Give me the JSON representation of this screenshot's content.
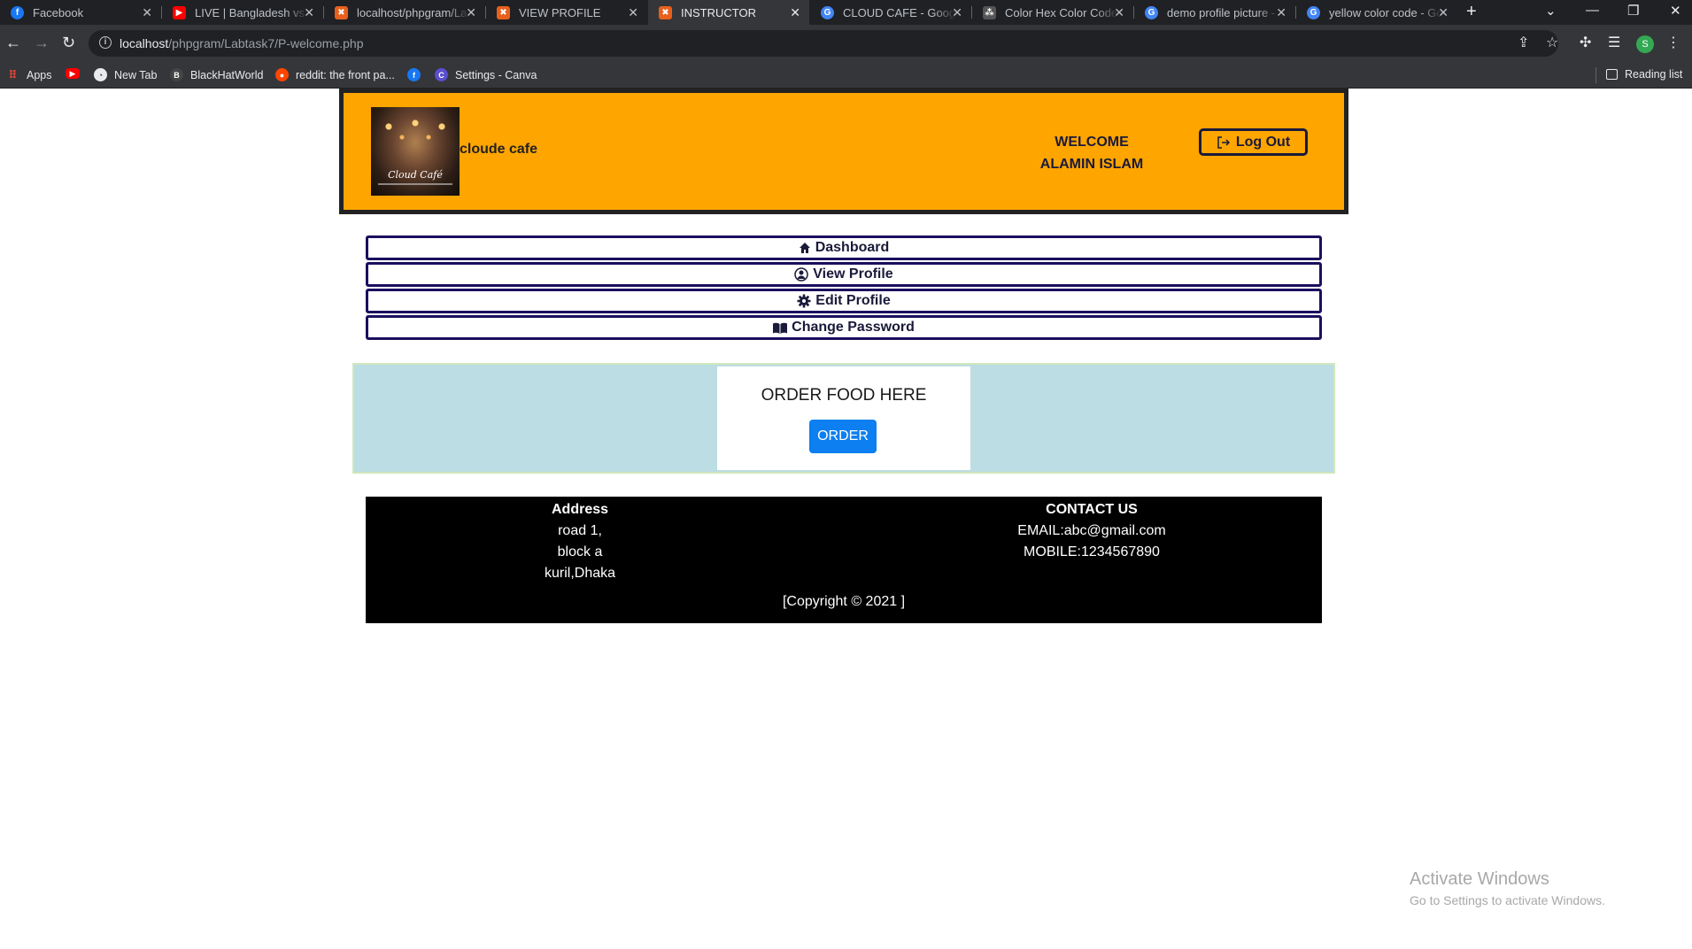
{
  "browser": {
    "tabs": [
      {
        "title": "Facebook",
        "favicon": "facebook-icon",
        "color": "#1877f2",
        "active": false
      },
      {
        "title": "LIVE | Bangladesh vs P",
        "favicon": "youtube-icon",
        "color": "#ff0000",
        "active": false
      },
      {
        "title": "localhost/phpgram/La",
        "favicon": "xampp-icon",
        "color": "#e8601c",
        "active": false
      },
      {
        "title": "VIEW PROFILE",
        "favicon": "xampp-icon",
        "color": "#e8601c",
        "active": false
      },
      {
        "title": "INSTRUCTOR",
        "favicon": "xampp-icon",
        "color": "#e8601c",
        "active": true
      },
      {
        "title": "CLOUD CAFE - Google",
        "favicon": "google-icon",
        "color": "#4285f4",
        "active": false
      },
      {
        "title": "Color Hex Color Codes",
        "favicon": "colorhex-icon",
        "color": "#555555",
        "active": false
      },
      {
        "title": "demo profile picture -",
        "favicon": "google-icon",
        "color": "#4285f4",
        "active": false
      },
      {
        "title": "yellow color code - Go",
        "favicon": "google-icon",
        "color": "#4285f4",
        "active": false
      }
    ],
    "url_host": "localhost",
    "url_path": "/phpgram/Labtask7/P-welcome.php",
    "profile_initial": "S",
    "bookmarks": [
      {
        "label": "Apps",
        "icon": "apps-grid-icon",
        "color": "#ea4335"
      },
      {
        "label": "",
        "icon": "youtube-icon",
        "color": "#ff0000"
      },
      {
        "label": "New Tab",
        "icon": "globe-icon",
        "color": "#e8eaed"
      },
      {
        "label": "BlackHatWorld",
        "icon": "blackhatworld-icon",
        "color": "#444444"
      },
      {
        "label": "reddit: the front pa...",
        "icon": "reddit-icon",
        "color": "#ff4500"
      },
      {
        "label": "",
        "icon": "facebook-icon",
        "color": "#1877f2"
      },
      {
        "label": "Settings - Canva",
        "icon": "canva-icon",
        "color": "#5a4fcf"
      }
    ],
    "reading_list": "Reading list"
  },
  "header": {
    "brand": "cloude cafe",
    "logo_text": "Cloud Café",
    "welcome_line1": "WELCOME",
    "welcome_line2": "ALAMIN ISLAM",
    "logout_label": "Log Out",
    "bg_color": "#ffa500"
  },
  "menu": {
    "items": [
      {
        "label": "Dashboard",
        "icon": "home-icon"
      },
      {
        "label": "View Profile",
        "icon": "user-circle-icon"
      },
      {
        "label": "Edit Profile",
        "icon": "gear-icon"
      },
      {
        "label": "Change Password",
        "icon": "book-icon"
      }
    ]
  },
  "order": {
    "title": "ORDER FOOD HERE",
    "button_label": "ORDER",
    "button_color": "#0d7ff0"
  },
  "footer": {
    "address_heading": "Address",
    "address_lines": [
      "road 1,",
      "block a",
      "kuril,Dhaka"
    ],
    "contact_heading": "CONTACT US",
    "email": "EMAIL:abc@gmail.com",
    "mobile": "MOBILE:1234567890",
    "copyright": "[Copyright © 2021 ]"
  },
  "watermark": {
    "line1": "Activate Windows",
    "line2": "Go to Settings to activate Windows."
  }
}
